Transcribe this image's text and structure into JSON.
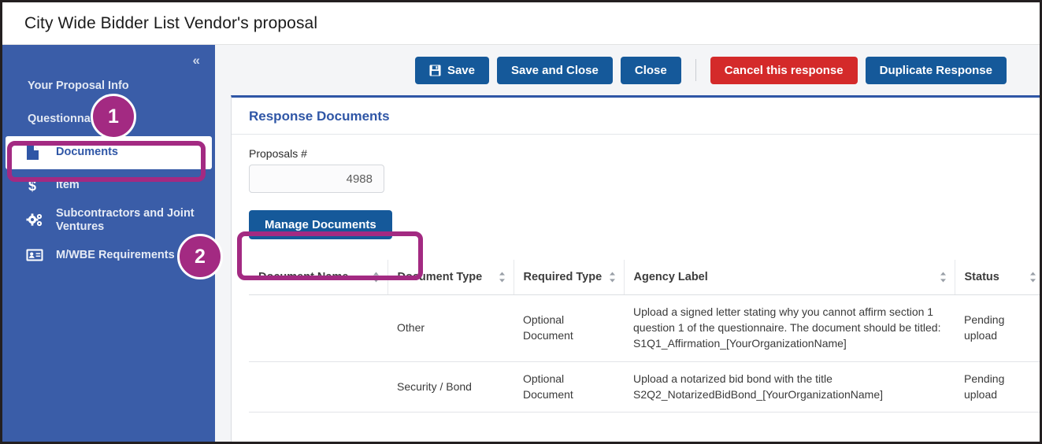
{
  "window": {
    "title": "City Wide Bidder List Vendor's proposal"
  },
  "sidebar": {
    "collapse_icon": "chevron-double-left",
    "items": [
      {
        "label": "Your Proposal Info",
        "icon": "",
        "active": false
      },
      {
        "label": "Questionnaire",
        "icon": "",
        "active": false
      },
      {
        "label": "Documents",
        "icon": "file-icon",
        "active": true
      },
      {
        "label": "Item",
        "icon": "dollar-icon",
        "active": false
      },
      {
        "label": "Subcontractors and Joint Ventures",
        "icon": "gears-icon",
        "active": false
      },
      {
        "label": "M/WBE Requirements",
        "icon": "id-card-icon",
        "active": false
      }
    ]
  },
  "annotations": {
    "badge_1": "1",
    "badge_2": "2"
  },
  "toolbar": {
    "save_label": "Save",
    "save_icon": "floppy-disk-icon",
    "save_and_close_label": "Save and Close",
    "close_label": "Close",
    "cancel_label": "Cancel this response",
    "duplicate_label": "Duplicate Response"
  },
  "card": {
    "title": "Response Documents",
    "proposals_label": "Proposals #",
    "proposals_value": "4988",
    "manage_documents_label": "Manage Documents"
  },
  "table": {
    "columns": [
      {
        "label": "Document Name",
        "sortable": true
      },
      {
        "label": "Document Type",
        "sortable": true
      },
      {
        "label": "Required Type",
        "sortable": true
      },
      {
        "label": "Agency Label",
        "sortable": true
      },
      {
        "label": "Status",
        "sortable": true
      }
    ],
    "rows": [
      {
        "document_name": "",
        "document_type": "Other",
        "required_type": "Optional Document",
        "agency_label": "Upload a signed letter stating why you cannot affirm section 1 question 1 of the questionnaire. The document should be titled: S1Q1_Affirmation_[YourOrganizationName]",
        "status": "Pending upload"
      },
      {
        "document_name": "",
        "document_type": "Security / Bond",
        "required_type": "Optional Document",
        "agency_label": "Upload a notarized bid bond with the title S2Q2_NotarizedBidBond_[YourOrganizationName]",
        "status": "Pending upload"
      }
    ]
  },
  "colors": {
    "sidebar_blue": "#3a5da8",
    "button_blue": "#15599a",
    "danger_red": "#d42a2a",
    "highlight_magenta": "#a32a82",
    "title_blue": "#2f56a6"
  }
}
